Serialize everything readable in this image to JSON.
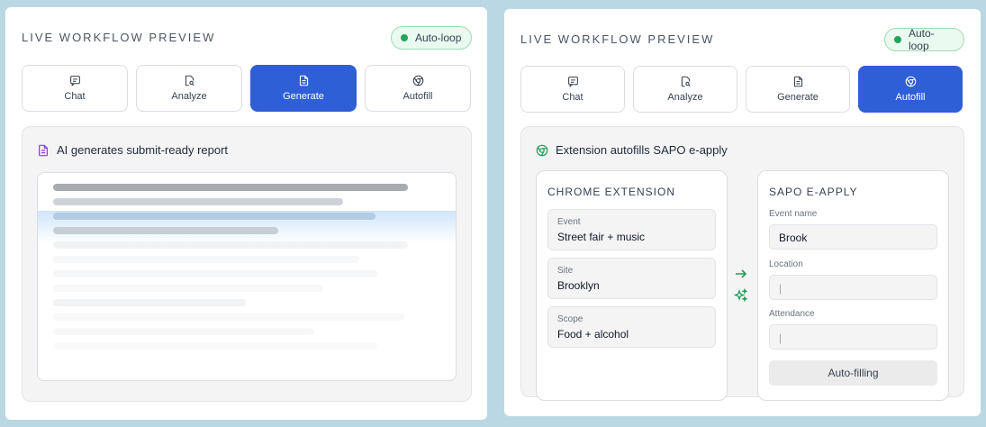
{
  "left": {
    "title": "LIVE WORKFLOW PREVIEW",
    "badge": "Auto-loop",
    "tabs": [
      {
        "label": "Chat",
        "icon": "chat-icon"
      },
      {
        "label": "Analyze",
        "icon": "file-search-icon"
      },
      {
        "label": "Generate",
        "icon": "document-icon",
        "active": true
      },
      {
        "label": "Autofill",
        "icon": "chrome-icon"
      }
    ],
    "content_header": "AI generates submit-ready report"
  },
  "right": {
    "title": "LIVE WORKFLOW PREVIEW",
    "badge": "Auto-loop",
    "tabs": [
      {
        "label": "Chat",
        "icon": "chat-icon"
      },
      {
        "label": "Analyze",
        "icon": "file-search-icon"
      },
      {
        "label": "Generate",
        "icon": "document-icon"
      },
      {
        "label": "Autofill",
        "icon": "chrome-icon",
        "active": true
      }
    ],
    "content_header": "Extension autofills SAPO e-apply",
    "extension": {
      "title": "CHROME EXTENSION",
      "fields": [
        {
          "label": "Event",
          "value": "Street fair + music"
        },
        {
          "label": "Site",
          "value": "Brooklyn"
        },
        {
          "label": "Scope",
          "value": "Food + alcohol"
        }
      ]
    },
    "sapo": {
      "title": "SAPO E-APPLY",
      "fields": [
        {
          "label": "Event name",
          "value": "Brook"
        },
        {
          "label": "Location",
          "value": "|"
        },
        {
          "label": "Attendance",
          "value": "|"
        }
      ],
      "button": "Auto-filling"
    }
  },
  "colors": {
    "accent": "#2f5fd6",
    "status_green": "#22a55a",
    "report_icon": "#8b3fd9",
    "chrome_icon_green": "#1f9d55",
    "background": "#b9d8e3"
  }
}
